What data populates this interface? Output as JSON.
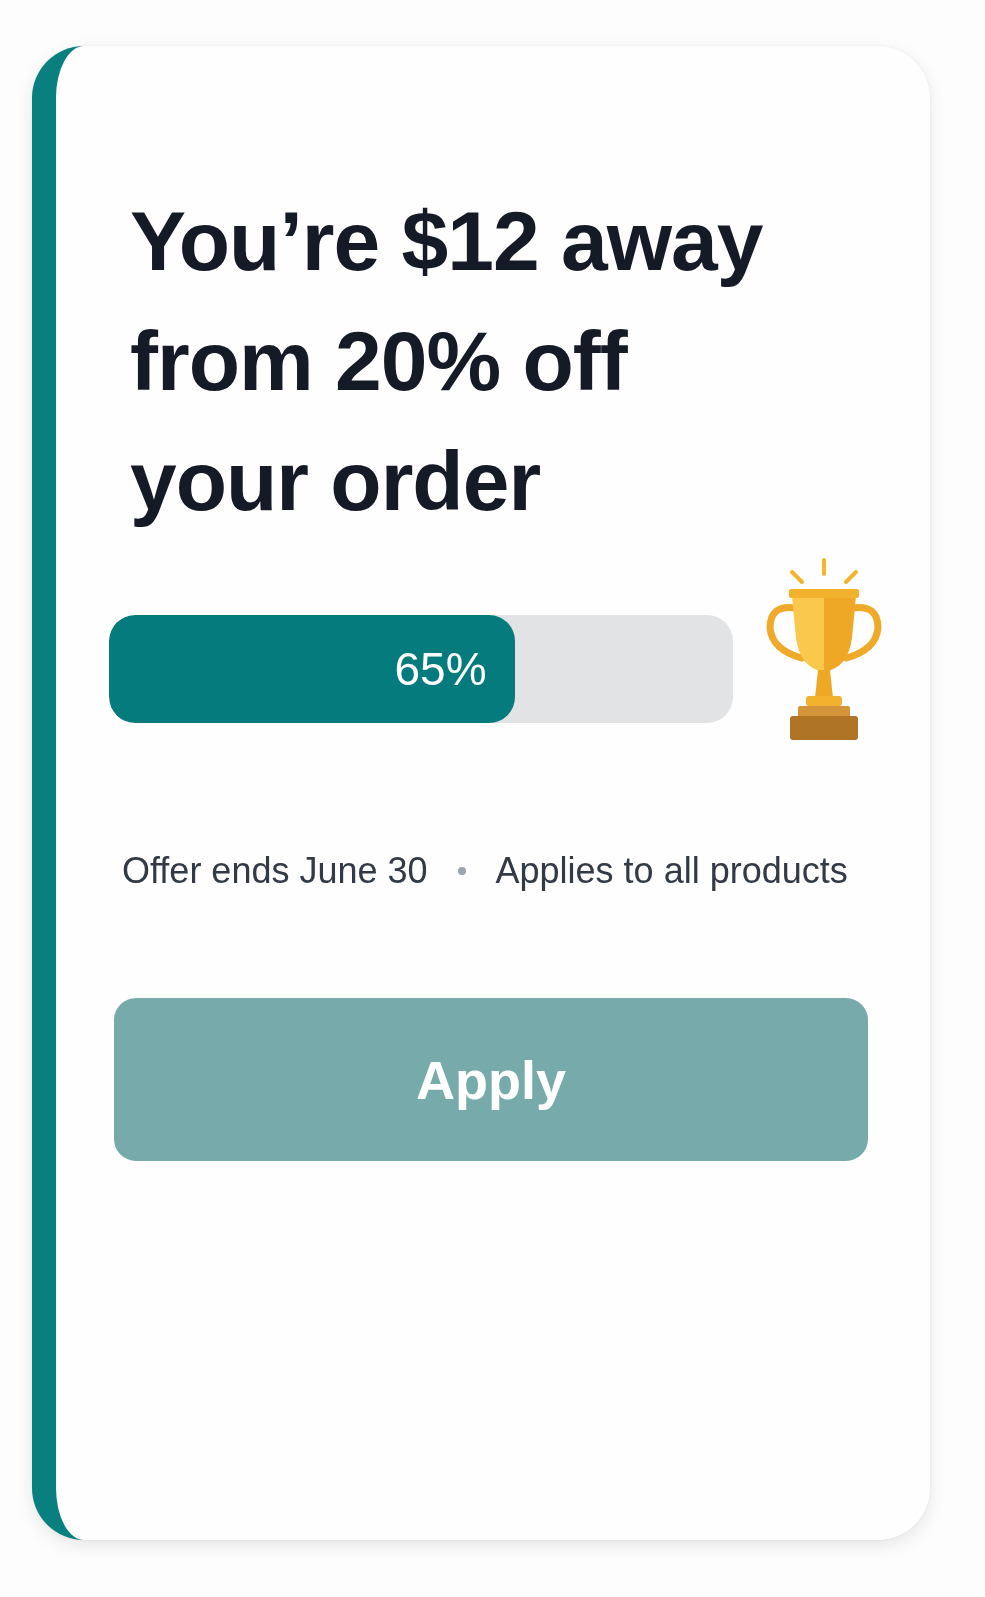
{
  "offer": {
    "headline": "You’re $12 away from 20% off your order"
  },
  "progress": {
    "level": 0.65,
    "label": "65%"
  },
  "details": [
    "Offer ends June 30",
    "Applies to all products"
  ],
  "button": {
    "label": "Apply",
    "disabled": true
  }
}
